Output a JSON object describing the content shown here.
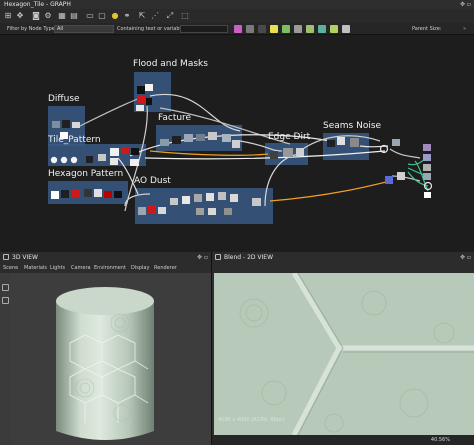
{
  "graph": {
    "title": "Hexagon_Tile - GRAPH",
    "filter_label": "Filter by Node Type",
    "filter_value": "All",
    "containing_label": "Containing text or variable",
    "parent_size_label": "Parent Size:",
    "frames": [
      {
        "label": "Flood and Masks"
      },
      {
        "label": "Diffuse"
      },
      {
        "label": "Facture"
      },
      {
        "label": "Tile_Pattern"
      },
      {
        "label": "Edge Dirt"
      },
      {
        "label": "Seams Noise"
      },
      {
        "label": "Hexagon Pattern"
      },
      {
        "label": "AO Dust"
      }
    ],
    "chip_colors": [
      "#c860c8",
      "#7a7a7a",
      "#4a4a4a",
      "#e8e050",
      "#7ac060",
      "#9a9a9a",
      "#a0c070",
      "#5ab0a0",
      "#b0d060",
      "#c0c0c0"
    ]
  },
  "view3d": {
    "title": "3D VIEW",
    "menu": [
      "Scene",
      "Materials",
      "Lights",
      "Camera",
      "Environment",
      "Display",
      "Renderer"
    ]
  },
  "view2d": {
    "title": "Blend - 2D VIEW",
    "resolution": "4096 x 4096 (RGBA, 8bpc)",
    "zoom": "40.56%"
  },
  "colors": {
    "frame_fill": "#3c5a86",
    "tile_color": "#b9cdbb",
    "seam_color": "#d6e3d7"
  }
}
